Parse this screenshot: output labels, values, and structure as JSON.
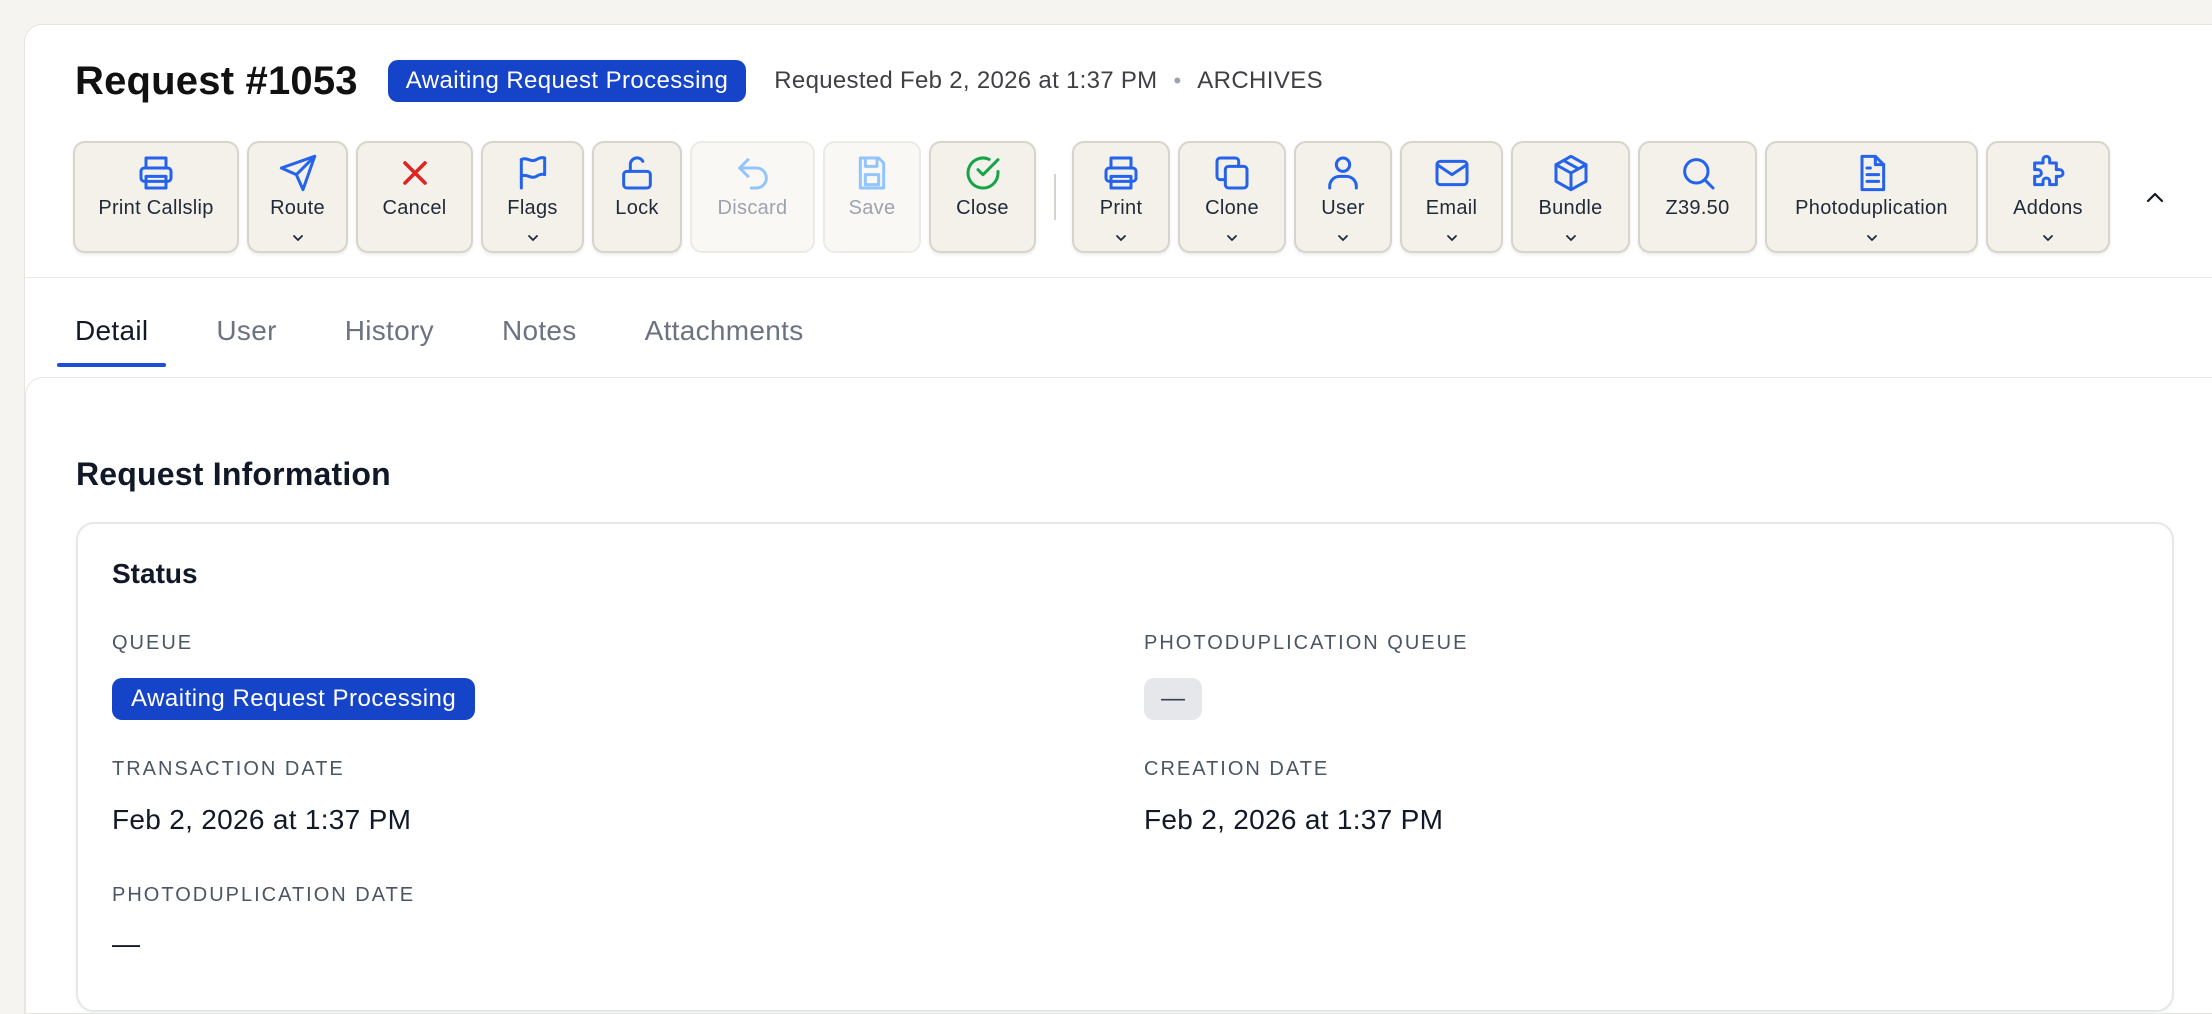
{
  "header": {
    "title": "Request #1053",
    "queue_badge": "Awaiting Request Processing",
    "requested": "Requested Feb 2, 2026 at 1:37 PM",
    "separator": "•",
    "department": "ARCHIVES"
  },
  "toolbar": {
    "print_callslip": "Print Callslip",
    "route": "Route",
    "cancel": "Cancel",
    "flags": "Flags",
    "lock": "Lock",
    "discard": "Discard",
    "save": "Save",
    "close": "Close",
    "print": "Print",
    "clone": "Clone",
    "user": "User",
    "email": "Email",
    "bundle": "Bundle",
    "z3950": "Z39.50",
    "photoduplication": "Photoduplication",
    "addons": "Addons"
  },
  "tabs": [
    "Detail",
    "User",
    "History",
    "Notes",
    "Attachments"
  ],
  "active_tab": "Detail",
  "main": {
    "section_title": "Request Information",
    "status_card": {
      "title": "Status",
      "queue_label": "QUEUE",
      "queue_value": "Awaiting Request Processing",
      "photo_queue_label": "PHOTODUPLICATION QUEUE",
      "photo_queue_value": "—",
      "transaction_date_label": "TRANSACTION DATE",
      "transaction_date_value": "Feb 2, 2026 at 1:37 PM",
      "creation_date_label": "CREATION DATE",
      "creation_date_value": "Feb 2, 2026 at 1:37 PM",
      "photo_date_label": "PHOTODUPLICATION DATE",
      "photo_date_value": "—"
    }
  },
  "colors": {
    "accent": "#1544c8",
    "icon_blue": "#2563eb",
    "cancel_red": "#dc2626",
    "close_green": "#16a34a",
    "disabled": "#93c5fd",
    "page_bg": "#f5f4f0"
  }
}
